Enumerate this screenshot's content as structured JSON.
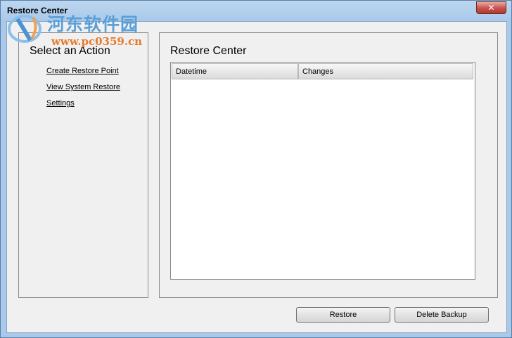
{
  "window": {
    "title": "Restore Center",
    "close_glyph": "✕"
  },
  "watermark": {
    "chinese_text": "河东软件园",
    "url": "www.pc0359.cn"
  },
  "left_panel": {
    "heading": "Select an Action",
    "actions": [
      {
        "label": "Create Restore Point"
      },
      {
        "label": "View System Restore"
      },
      {
        "label": "Settings"
      }
    ]
  },
  "right_panel": {
    "heading": "Restore Center",
    "columns": [
      {
        "label": "Datetime"
      },
      {
        "label": "Changes"
      }
    ],
    "rows": []
  },
  "buttons": {
    "restore": "Restore",
    "delete_backup": "Delete Backup"
  },
  "colors": {
    "close_button": "#c75050",
    "watermark_text": "#5aa0d8",
    "watermark_url": "#e87a2a"
  }
}
